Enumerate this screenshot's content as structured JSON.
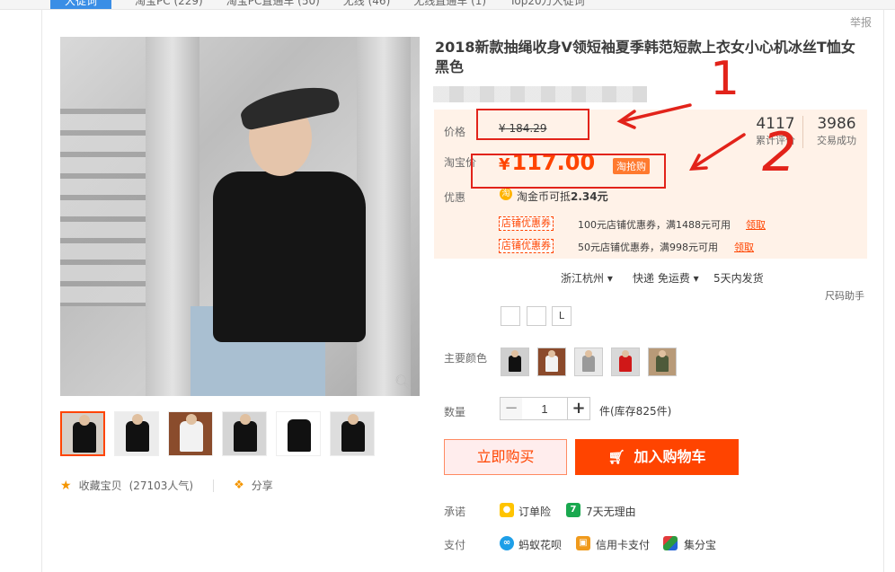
{
  "top_tabs": [
    "大徒词",
    "淘宝PC (229)",
    "淘宝PC直通车 (50)",
    "无线 (46)",
    "无线直通车 (1)",
    "Top20万大徒词"
  ],
  "report_label": "举报",
  "product": {
    "title": "2018新款抽绳收身V领短袖夏季韩范短款上衣女小心机冰丝T恤女黑色"
  },
  "price": {
    "label": "价格",
    "currency": "¥",
    "original": "184.29",
    "taobao_label": "淘宝价",
    "taobao_value": "117.00",
    "tqg_badge": "淘抢购"
  },
  "stats": {
    "reviews_num": "4117",
    "reviews_label": "累计评价",
    "sales_num": "3986",
    "sales_label": "交易成功"
  },
  "promo": {
    "label": "优惠",
    "coin_text": "淘金币可抵",
    "coin_amount": "2.34元",
    "coupon_tag": "店铺优惠券",
    "coupons": [
      {
        "desc": "100元店铺优惠券，满1488元可用",
        "action": "领取"
      },
      {
        "desc": "50元店铺优惠券，满998元可用",
        "action": "领取"
      }
    ]
  },
  "shipping": {
    "from": "浙江杭州",
    "method": "快递 免运费",
    "delivery": "5天内发货",
    "size_helper": "尺码助手"
  },
  "size_option": "L",
  "color_label": "主要颜色",
  "qty": {
    "label": "数量",
    "value": "1",
    "stock": "件(库存825件)"
  },
  "buttons": {
    "buy_now": "立即购买",
    "add_cart": "加入购物车"
  },
  "promise": {
    "label": "承诺",
    "items": [
      "订单险",
      "7天无理由"
    ],
    "seven_icon": "7"
  },
  "payment": {
    "label": "支付",
    "items": [
      "蚂蚁花呗",
      "信用卡支付",
      "集分宝"
    ]
  },
  "social": {
    "favorite": "收藏宝贝",
    "popularity": "(27103人气)",
    "share": "分享"
  },
  "annotations": [
    "1",
    "2"
  ],
  "colors": {
    "accent": "#ff4400",
    "annotation": "#e2231a",
    "price_bg": "#fff2e8"
  }
}
